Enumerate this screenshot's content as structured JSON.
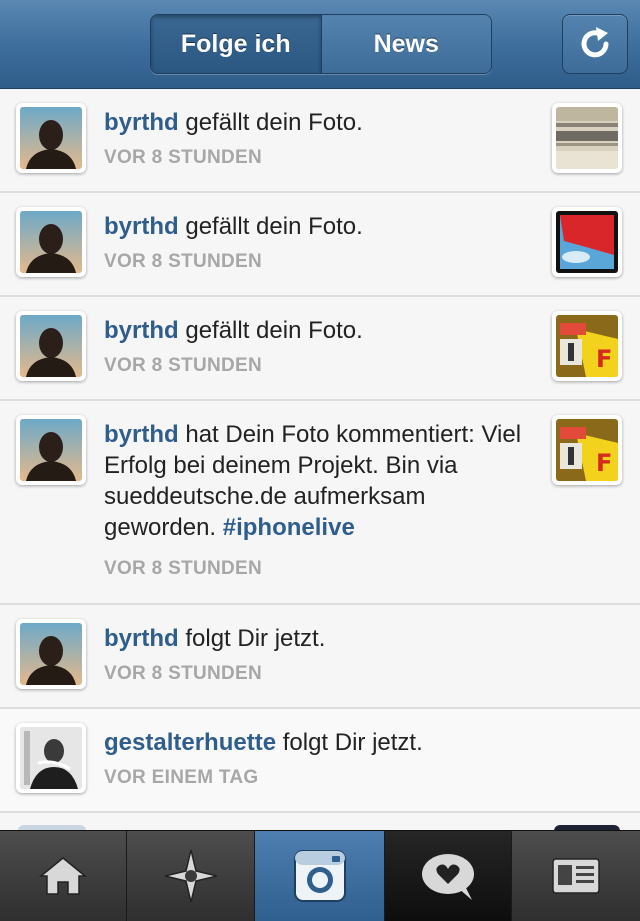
{
  "header": {
    "tabs": [
      "Folge ich",
      "News"
    ],
    "active_tab": "News",
    "refresh_icon": "refresh-icon"
  },
  "feed": [
    {
      "user": "byrthd",
      "action": " gefällt dein Foto.",
      "time": "VOR 8 STUNDEN",
      "thumb": "photo-building"
    },
    {
      "user": "byrthd",
      "action": " gefällt dein Foto.",
      "time": "VOR 8 STUNDEN",
      "thumb": "photo-red-sky"
    },
    {
      "user": "byrthd",
      "action": " gefällt dein Foto.",
      "time": "VOR 8 STUNDEN",
      "thumb": "photo-yellow-sticker"
    },
    {
      "user": "byrthd",
      "action": " hat Dein Foto kommentiert: Viel Erfolg bei deinem Projekt. Bin via sueddeutsche.de aufmerksam geworden. ",
      "hashtag": "#iphonelive",
      "time": "VOR 8 STUNDEN",
      "thumb": "photo-yellow-sticker"
    },
    {
      "user": "byrthd",
      "action": " folgt Dir jetzt.",
      "time": "VOR 8 STUNDEN"
    },
    {
      "user": "gestalterhuette",
      "action": " folgt Dir jetzt.",
      "time": "VOR EINEM TAG"
    }
  ],
  "tabbar": {
    "items": [
      "home-icon",
      "explore-icon",
      "camera-icon",
      "news-icon",
      "profile-icon"
    ],
    "active": "camera-icon"
  },
  "colors": {
    "accent": "#2f5e8d",
    "header": "#3f6f9d",
    "time": "#a7a7a7"
  }
}
